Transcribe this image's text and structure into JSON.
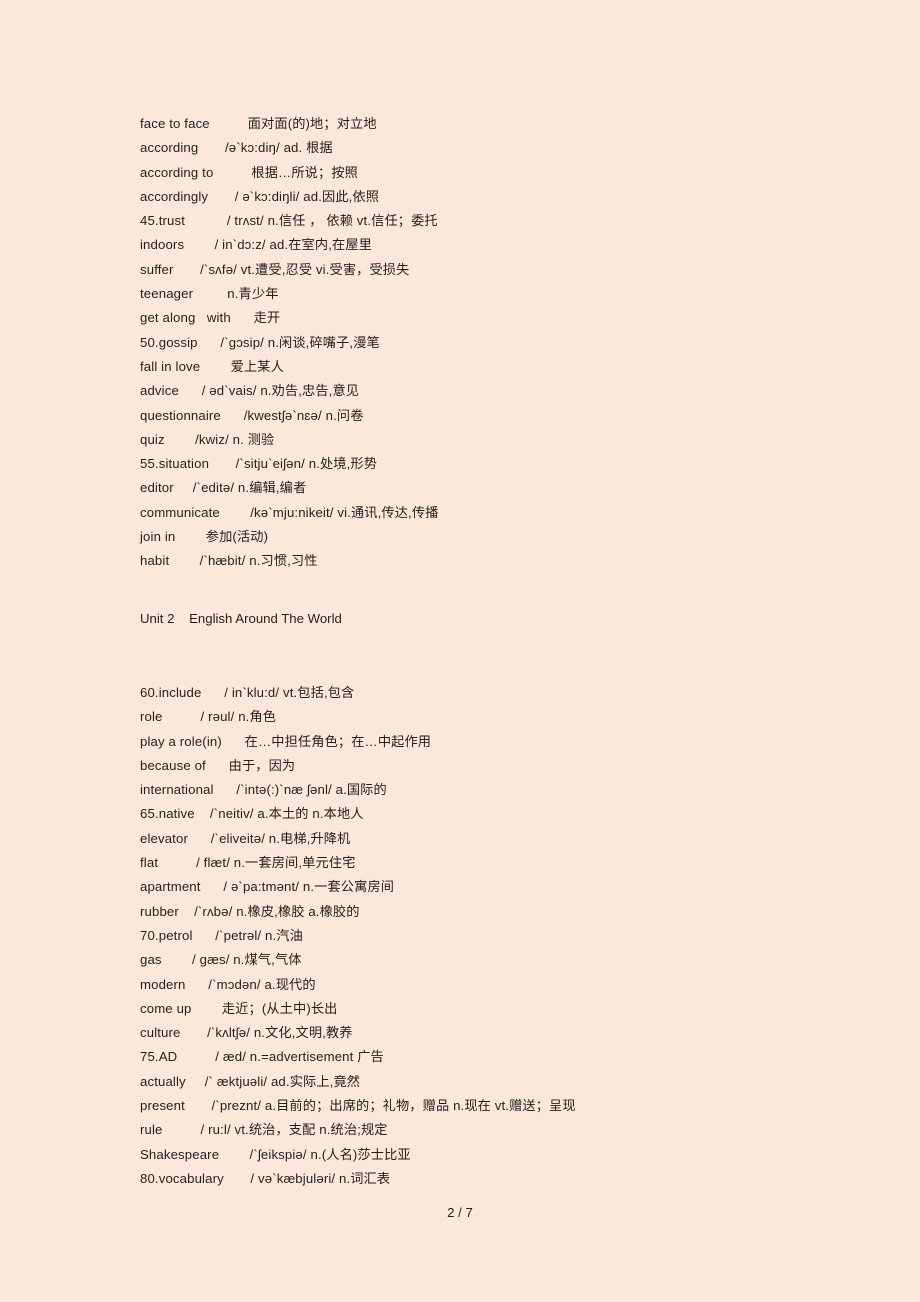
{
  "document": {
    "background_color": "#fbe8db",
    "text_color": "#231f1c",
    "footer": "2 / 7"
  },
  "sections": [
    {
      "id": "unit1-continued",
      "heading": null,
      "entries": [
        {
          "term": "face to face",
          "gap": "          ",
          "definition": "面对面(的)地；对立地"
        },
        {
          "term": "according",
          "gap": "       ",
          "definition": "/ə`kɔ:diŋ/ ad. 根据"
        },
        {
          "term": "according to",
          "gap": "          ",
          "definition": "根据…所说；按照"
        },
        {
          "term": "accordingly",
          "gap": "       ",
          "definition": "/ ə`kɔ:diŋli/ ad.因此,依照"
        },
        {
          "term": "45.trust",
          "gap": "           ",
          "definition": "/ trʌst/ n.信任 ， 依赖 vt.信任；委托"
        },
        {
          "term": "indoors",
          "gap": "        ",
          "definition": "/ in`dɔ:z/ ad.在室内,在屋里"
        },
        {
          "term": "suffer",
          "gap": "       ",
          "definition": "/`sʌfə/ vt.遭受,忍受 vi.受害，受损失"
        },
        {
          "term": "teenager",
          "gap": "         ",
          "definition": "n.青少年"
        },
        {
          "term": "get along   with",
          "gap": "      ",
          "definition": "走开"
        },
        {
          "term": "50.gossip",
          "gap": "      ",
          "definition": "/`gɔsip/ n.闲谈,碎嘴子,漫笔"
        },
        {
          "term": "fall in love",
          "gap": "        ",
          "definition": "爱上某人"
        },
        {
          "term": "advice",
          "gap": "      ",
          "definition": "/ əd`vais/ n.劝告,忠告,意见"
        },
        {
          "term": "questionnaire",
          "gap": "      ",
          "definition": "/kwestʃə`nɛə/ n.问卷"
        },
        {
          "term": "quiz",
          "gap": "        ",
          "definition": "/kwiz/ n. 测验"
        },
        {
          "term": "55.situation",
          "gap": "       ",
          "definition": "/`sitju`eiʃən/ n.处境,形势"
        },
        {
          "term": "editor",
          "gap": "     ",
          "definition": "/`editə/ n.编辑,编者"
        },
        {
          "term": "communicate",
          "gap": "        ",
          "definition": "/kə`mju:nikeit/ vi.通讯,传达,传播"
        },
        {
          "term": "join in",
          "gap": "        ",
          "definition": "参加(活动)"
        },
        {
          "term": "habit",
          "gap": "        ",
          "definition": "/`hæbit/ n.习惯,习性"
        }
      ]
    },
    {
      "id": "unit2",
      "heading": "Unit 2    English Around The World",
      "entries": [
        {
          "term": "60.include",
          "gap": "      ",
          "definition": "/ in`klu:d/ vt.包括,包含"
        },
        {
          "term": "role",
          "gap": "          ",
          "definition": "/ rəul/ n.角色"
        },
        {
          "term": "play a role(in)",
          "gap": "      ",
          "definition": "在…中担任角色；在…中起作用"
        },
        {
          "term": "because of",
          "gap": "      ",
          "definition": "由于，因为"
        },
        {
          "term": "international",
          "gap": "      ",
          "definition": "/`intə(:)`næ ʃənl/ a.国际的"
        },
        {
          "term": "65.native",
          "gap": "    ",
          "definition": "/`neitiv/ a.本土的 n.本地人"
        },
        {
          "term": "elevator",
          "gap": "      ",
          "definition": "/`eliveitə/ n.电梯,升降机"
        },
        {
          "term": "flat",
          "gap": "          ",
          "definition": "/ flæt/ n.一套房间,单元住宅"
        },
        {
          "term": "apartment",
          "gap": "      ",
          "definition": "/ ə`pa:tmənt/ n.一套公寓房间"
        },
        {
          "term": "rubber",
          "gap": "    ",
          "definition": "/`rʌbə/ n.橡皮,橡胶 a.橡胶的"
        },
        {
          "term": "70.petrol",
          "gap": "      ",
          "definition": "/`petrəl/ n.汽油"
        },
        {
          "term": "gas",
          "gap": "        ",
          "definition": "/ gæs/ n.煤气,气体"
        },
        {
          "term": "modern",
          "gap": "      ",
          "definition": "/`mɔdən/ a.现代的"
        },
        {
          "term": "come up",
          "gap": "        ",
          "definition": "走近；(从土中)长出"
        },
        {
          "term": "culture",
          "gap": "       ",
          "definition": "/`kʌltʃə/ n.文化,文明,教养"
        },
        {
          "term": "75.AD",
          "gap": "          ",
          "definition": "/ æd/ n.=advertisement 广告"
        },
        {
          "term": "actually",
          "gap": "     ",
          "definition": "/` æktjuəli/ ad.实际上,竟然"
        },
        {
          "term": "present",
          "gap": "       ",
          "definition": "/`preznt/ a.目前的；出席的；礼物，赠品 n.现在 vt.赠送；呈现"
        },
        {
          "term": "rule",
          "gap": "          ",
          "definition": "/ ru:l/ vt.统治，支配 n.统治;规定"
        },
        {
          "term": "Shakespeare",
          "gap": "        ",
          "definition": "/`ʃeikspiə/ n.(人名)莎士比亚"
        },
        {
          "term": "80.vocabulary",
          "gap": "       ",
          "definition": "/ və`kæbjuləri/ n.词汇表"
        }
      ]
    }
  ]
}
